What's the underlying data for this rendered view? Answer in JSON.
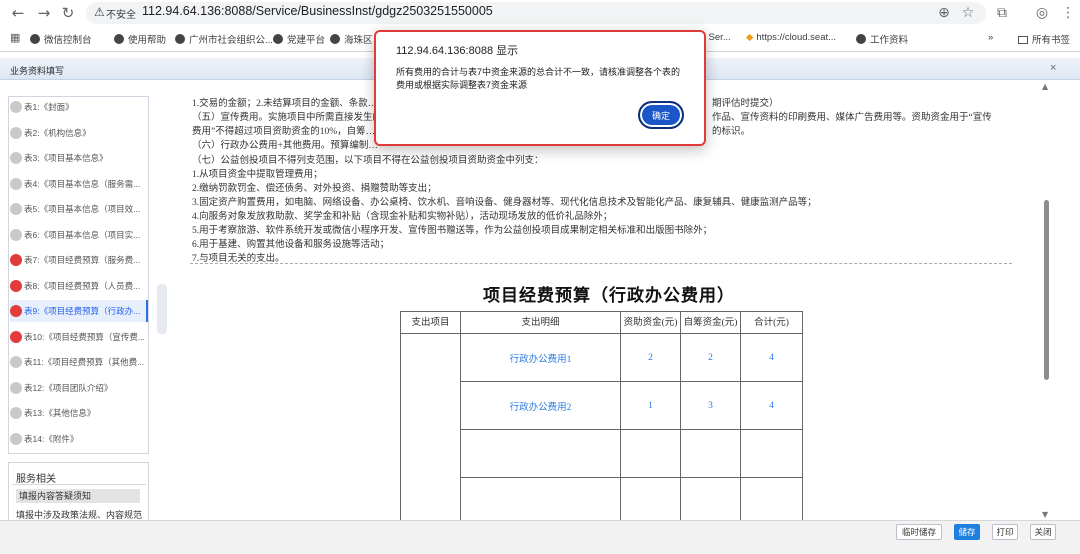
{
  "browser": {
    "insecure_label": "不安全",
    "url": "112.94.64.136:8088/Service/BusinessInst/gdgz2503251550005",
    "bookmarks": [
      "微信控制台",
      "使用帮助",
      "广州市社会组织公...",
      "党建平台",
      "海珠区",
      "...fe Ser...",
      "https://cloud.seat...",
      "工作资料",
      "所有书签"
    ]
  },
  "app": {
    "title": "业务资料填写"
  },
  "sidebar": {
    "items": [
      {
        "label": "表1:《封面》",
        "status": "gray"
      },
      {
        "label": "表2:《机构信息》",
        "status": "gray"
      },
      {
        "label": "表3:《项目基本信息》",
        "status": "gray"
      },
      {
        "label": "表4:《项目基本信息（服务需...",
        "status": "gray"
      },
      {
        "label": "表5:《项目基本信息（项目效...",
        "status": "gray"
      },
      {
        "label": "表6:《项目基本信息（项目实...",
        "status": "gray"
      },
      {
        "label": "表7:《项目经费预算（服务费...",
        "status": "red"
      },
      {
        "label": "表8:《项目经费预算（人员费...",
        "status": "red"
      },
      {
        "label": "表9:《项目经费预算（行政办...",
        "status": "active"
      },
      {
        "label": "表10:《项目经费预算（宣传费...",
        "status": "red"
      },
      {
        "label": "表11:《项目经费预算（其他费...",
        "status": "gray"
      },
      {
        "label": "表12:《项目团队介绍》",
        "status": "gray"
      },
      {
        "label": "表13:《其他信息》",
        "status": "gray"
      },
      {
        "label": "表14:《附件》",
        "status": "gray"
      }
    ]
  },
  "service": {
    "title": "服务相关",
    "item1": "填报内容答疑须知",
    "item2": "填报中涉及政策法规、内容规范"
  },
  "content": {
    "lines": [
      "1.交易的金额；2.未结算项目的金额、条款…",
      "（五）宣传费用。实施项目中所需直接发生的…",
      "费用”不得超过项目资助资金的10%，自筹…",
      "（六）行政办公费用+其他费用。预算编制…",
      "（七）公益创投项目不得列支范围，以下项目不得在公益创投项目资助资金中列支：",
      "1.从项目资金中提取管理费用；",
      "2.缴纳罚款罚金、偿还债务、对外投资、捐赠赞助等支出；",
      "3.固定资产购置费用，如电脑、网络设备、办公桌椅、饮水机、音响设备、健身器材等、现代化信息技术及智能化产品、康复辅具、健康监测产品等；",
      "4.向服务对象发放救助款、奖学金和补贴（含现金补贴和实物补贴），活动现场发放的低价礼品除外；",
      "5.用于考察旅游、软件系统开发或微信小程序开发、宣传图书赠送等，作为公益创投项目成果制定相关标准和出版图书除外；",
      "6.用于基建、购置其他设备和服务设施等活动；",
      "7.与项目无关的支出。"
    ],
    "line_tail_1": "期评估时提交）",
    "line_tail_2": "作品、宣传资料的印刷费用、媒体广告费用等。资助资金用于“宣传",
    "line_tail_3": "的标识。",
    "table_title": "项目经费预算（行政办公费用）",
    "table": {
      "headers": [
        "支出项目",
        "支出明细",
        "资助资金(元)",
        "自筹资金(元)",
        "合计(元)"
      ],
      "rows": [
        {
          "detail": "行政办公费用1",
          "grant": "2",
          "self": "2",
          "total": "4"
        },
        {
          "detail": "行政办公费用2",
          "grant": "1",
          "self": "3",
          "total": "4"
        },
        {
          "detail": "",
          "grant": "",
          "self": "",
          "total": ""
        },
        {
          "detail": "",
          "grant": "",
          "self": "",
          "total": ""
        }
      ]
    }
  },
  "buttons": {
    "temp_save": "临时储存",
    "save": "储存",
    "print": "打印",
    "close": "关闭"
  },
  "dialog": {
    "title": "112.94.64.136:8088 显示",
    "message": "所有费用的合计与表7中资金来源的总合计不一致，请核准调整各个表的费用或根据实际调整表7资金来源",
    "ok": "确定"
  },
  "colors": {
    "accent": "#1f80e0",
    "dialog_border": "#e03b3b",
    "link": "#2b7be4"
  }
}
